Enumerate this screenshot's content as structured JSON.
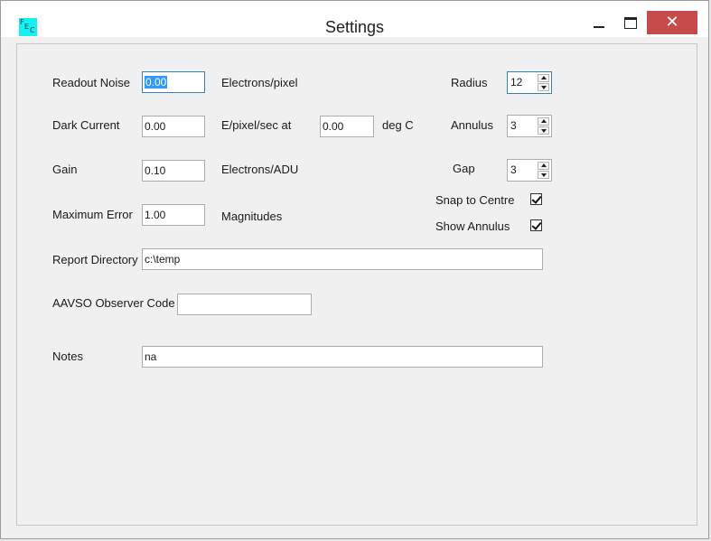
{
  "window": {
    "title": "Settings",
    "close_glyph": "✕"
  },
  "icons": {
    "app": "app-logo-icon",
    "minimize": "minimize-icon",
    "maximize": "maximize-icon",
    "close": "close-icon"
  },
  "colors": {
    "app_icon": "#16f0f0",
    "close_button": "#c74b4b",
    "selection": "#3399ff"
  },
  "fields": {
    "readout_noise": {
      "label": "Readout Noise",
      "value": "0.00",
      "unit": "Electrons/pixel"
    },
    "dark_current": {
      "label": "Dark Current",
      "value": "0.00",
      "unit": "E/pixel/sec at",
      "temp_value": "0.00",
      "temp_unit": "deg C"
    },
    "gain": {
      "label": "Gain",
      "value": "0.10",
      "unit": "Electrons/ADU"
    },
    "maximum_error": {
      "label": "Maximum Error",
      "value": "1.00",
      "unit": "Magnitudes"
    },
    "report_directory": {
      "label": "Report Directory",
      "value": "c:\\temp"
    },
    "aavso_code": {
      "label": "AAVSO Observer Code",
      "value": ""
    },
    "notes": {
      "label": "Notes",
      "value": "na"
    }
  },
  "aperture": {
    "radius": {
      "label": "Radius",
      "value": "12"
    },
    "annulus": {
      "label": "Annulus",
      "value": "3"
    },
    "gap": {
      "label": "Gap",
      "value": "3"
    },
    "snap_to_centre": {
      "label": "Snap to Centre",
      "checked": true
    },
    "show_annulus": {
      "label": "Show Annulus",
      "checked": true
    }
  }
}
